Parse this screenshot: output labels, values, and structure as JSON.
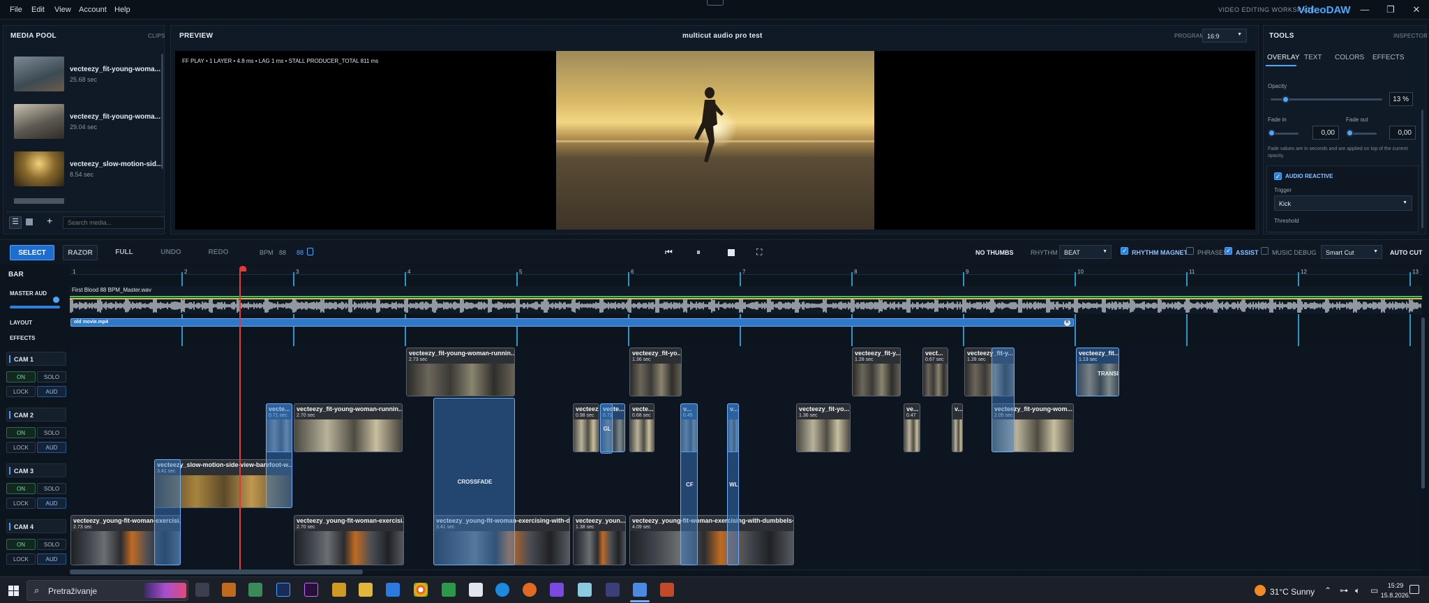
{
  "menu": [
    "File",
    "Edit",
    "View",
    "Account",
    "Help"
  ],
  "brand": {
    "subtitle": "VIDEO EDITING WORKSPACE",
    "name": "VideoDAW"
  },
  "window_controls": {
    "minimize": "—",
    "maximize": "❐",
    "close": "✕"
  },
  "media_pool": {
    "title": "MEDIA POOL",
    "sub": "CLIPS",
    "items": [
      {
        "name": "vecteezy_fit-young-woma...",
        "duration": "25.68 sec"
      },
      {
        "name": "vecteezy_fit-young-woma...",
        "duration": "29.04 sec"
      },
      {
        "name": "vecteezy_slow-motion-sid...",
        "duration": "8.54 sec"
      }
    ],
    "search_placeholder": "Search media..."
  },
  "preview": {
    "title": "PREVIEW",
    "project": "multicut audio pro test",
    "program_label": "PROGRAM",
    "aspect": "16:9",
    "stats": "FF PLAY • 1 LAYER • 4.8 ms • LAG 1 ms • STALL PRODUCER_TOTAL 811 ms"
  },
  "tools": {
    "title": "TOOLS",
    "sub": "INSPECTOR",
    "tabs": [
      "OVERLAY",
      "TEXT",
      "COLORS",
      "EFFECTS"
    ],
    "opacity_label": "Opacity",
    "opacity_value": "13",
    "opacity_unit": "%",
    "opacity_level": 0.13,
    "fade_in_label": "Fade in",
    "fade_in_value": "0,00",
    "fade_out_label": "Fade out",
    "fade_out_value": "0,00",
    "fade_note": "Fade values are in seconds and are applied on top of the current opacity.",
    "audio_reactive": "AUDIO REACTIVE",
    "trigger_label": "Trigger",
    "trigger_value": "Kick",
    "threshold_label": "Threshold"
  },
  "toolbar": {
    "select": "SELECT",
    "razor": "RAZOR",
    "full": "FULL",
    "undo": "UNDO",
    "redo": "REDO",
    "bpm_label": "BPM",
    "bpm_value": "88",
    "bpm_value2": "88",
    "no_thumbs": "NO THUMBS",
    "rhythm_label": "RHYTHM",
    "rhythm_value": "BEAT",
    "rhythm_magnet": "RHYTHM MAGNET",
    "phrases": "PHRASES",
    "assist": "ASSIST",
    "music_debug": "MUSIC DEBUG",
    "smart_cut": "Smart Cut",
    "auto_cut": "AUTO CUT"
  },
  "timeline": {
    "bar_label": "BAR",
    "bars": [
      "1",
      "2",
      "3",
      "4",
      "5",
      "6",
      "7",
      "8",
      "9",
      "10",
      "11",
      "12",
      "13"
    ],
    "master_aud": "MASTER AUD",
    "audio_file": "First Blood 88 BPM_Master.wav",
    "layout_label": "LAYOUT",
    "layout_clip": "old movie.mp4",
    "layout_badge": "R",
    "effects_label": "EFFECTS",
    "cams": [
      {
        "name": "CAM 1",
        "on": "ON",
        "solo": "SOLO",
        "lock": "LOCK",
        "aud": "AUD"
      },
      {
        "name": "CAM 2",
        "on": "ON",
        "solo": "SOLO",
        "lock": "LOCK",
        "aud": "AUD"
      },
      {
        "name": "CAM 3",
        "on": "ON",
        "solo": "SOLO",
        "lock": "LOCK",
        "aud": "AUD"
      },
      {
        "name": "CAM 4",
        "on": "ON",
        "solo": "SOLO",
        "lock": "LOCK",
        "aud": "AUD"
      }
    ],
    "clips": {
      "c1a": {
        "name": "vecteezy_fit-young-woman-runnin...",
        "dur": "2.73 sec"
      },
      "c1b": {
        "name": "vecteezy_fit-yo...",
        "dur": "1.36 sec"
      },
      "c1c": {
        "name": "vecteezy_fit-y...",
        "dur": "1.28 sec"
      },
      "c1d": {
        "name": "vect...",
        "dur": "0.67 sec"
      },
      "c1e": {
        "name": "vecteezy_fit-y...",
        "dur": "1.28 sec"
      },
      "c1f": {
        "name": "vecteezy_fit...",
        "dur": "1.13 sec",
        "label": "TRANSITION"
      },
      "c2a": {
        "name": "vecte...",
        "dur": "0.71 sec"
      },
      "c2b": {
        "name": "vecteezy_fit-young-woman-runnin...",
        "dur": "2.70 sec"
      },
      "c2c": {
        "name": "vecteez...",
        "dur": "0.98 sec"
      },
      "c2d": {
        "name": "vecte...",
        "dur": "0.71"
      },
      "c2e": {
        "name": "vecte...",
        "dur": "0.68 sec"
      },
      "c2f": {
        "name": "v...",
        "dur": "0.45"
      },
      "c2g": {
        "name": "v..."
      },
      "c2h": {
        "name": "vecteezy_fit-yo...",
        "dur": "1.36 sec"
      },
      "c2i": {
        "name": "ve...",
        "dur": "0.47"
      },
      "c2j": {
        "name": "v..."
      },
      "c2k": {
        "name": "vecteezy_fit-young-wom...",
        "dur": "2.05 sec"
      },
      "c3a": {
        "name": "vecteezy_slow-motion-side-view-barefoot-w...",
        "dur": "3.41 sec"
      },
      "c4a": {
        "name": "vecteezy_young-fit-woman-exercisi...",
        "dur": "2.73 sec"
      },
      "c4b": {
        "name": "vecteezy_young-fit-woman-exercisi...",
        "dur": "2.70 sec"
      },
      "c4c": {
        "name": "vecteezy_young-fit-woman-exercising-with-d...",
        "dur": "3.41 sec"
      },
      "c4d": {
        "name": "vecteezy_youn...",
        "dur": "1.38 sec"
      },
      "c4e": {
        "name": "vecteezy_young-fit-woman-exercising-with-dumbbels-i...",
        "dur": "4.09 sec"
      }
    },
    "crossfade": "CROSSFADE",
    "cf": "CF",
    "wl": "WL",
    "gl": "GL"
  },
  "taskbar": {
    "search": "Pretraživanje",
    "weather": "31°C  Sunny",
    "time": "15:29",
    "date": "15.8.2026."
  },
  "colors": {
    "accent": "#4aa8ff",
    "playhead": "#e53935"
  }
}
